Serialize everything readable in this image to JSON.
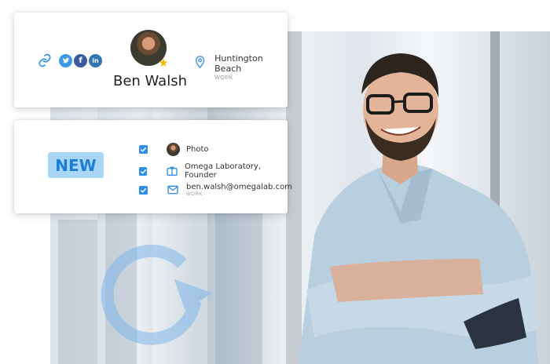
{
  "profile": {
    "name": "Ben Walsh",
    "location": "Huntington Beach",
    "location_label": "WORK",
    "social": [
      "twitter-icon",
      "facebook-icon",
      "linkedin-icon"
    ]
  },
  "new_card": {
    "badge": "NEW",
    "features": [
      {
        "label": "Photo",
        "sublabel": ""
      },
      {
        "label": "Omega Laboratory, Founder",
        "sublabel": ""
      },
      {
        "label": "ben.walsh@omegalab.com",
        "sublabel": "WORK"
      }
    ]
  },
  "colors": {
    "accent": "#2f8fe6",
    "new_badge_bg": "#a9d6f6",
    "new_badge_text": "#1c7fd6",
    "twitter": "#3d9ae8",
    "facebook": "#3b5aa0",
    "linkedin": "#2f76b5",
    "star": "#f5b800"
  }
}
